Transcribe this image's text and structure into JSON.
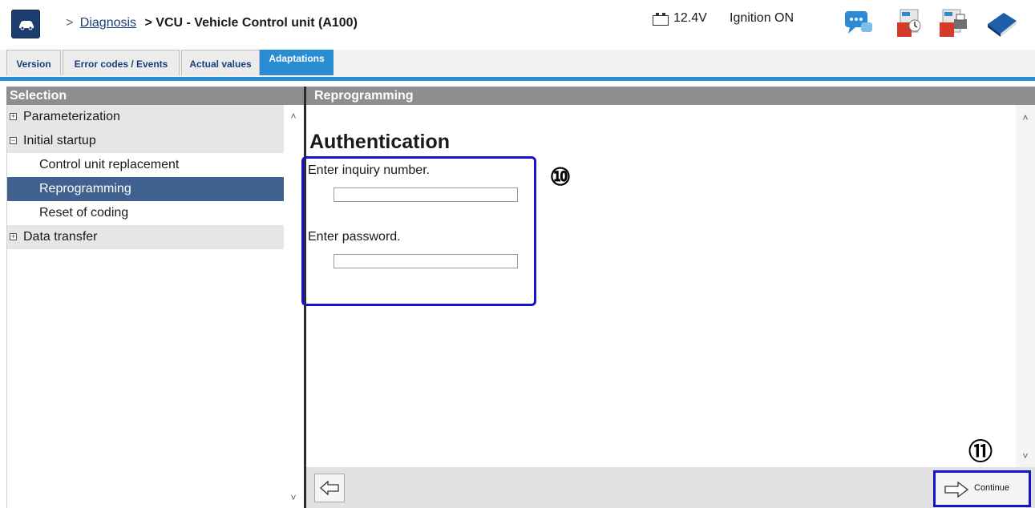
{
  "header": {
    "breadcrumb_sep": ">",
    "breadcrumb_link": "Diagnosis",
    "title": "> VCU - Vehicle Control unit (A100)",
    "voltage": "12.4V",
    "ignition": "Ignition ON",
    "icons": [
      "car-home-icon",
      "chat-icon",
      "pdf-clock-icon",
      "pdf-print-icon",
      "book-icon"
    ]
  },
  "tabs": [
    {
      "label": "Version",
      "active": false
    },
    {
      "label": "Error codes / Events",
      "active": false
    },
    {
      "label": "Actual values",
      "active": false
    },
    {
      "label": "Adaptations",
      "active": true
    }
  ],
  "left": {
    "header": "Selection",
    "tree": [
      {
        "label": "Parameterization",
        "type": "group",
        "expanded": false
      },
      {
        "label": "Initial startup",
        "type": "group",
        "expanded": true
      },
      {
        "label": "Control unit replacement",
        "type": "child",
        "selected": false
      },
      {
        "label": "Reprogramming",
        "type": "child",
        "selected": true
      },
      {
        "label": "Reset of coding",
        "type": "child",
        "selected": false
      },
      {
        "label": "Data transfer",
        "type": "group",
        "expanded": false
      }
    ]
  },
  "right": {
    "header": "Reprogramming",
    "title": "Authentication",
    "inquiry_label": "Enter inquiry number.",
    "inquiry_value": "",
    "password_label": "Enter password.",
    "password_value": "",
    "marker_a": "⑩",
    "marker_b": "⑪"
  },
  "footer": {
    "continue_label": "Continue"
  },
  "colors": {
    "accent": "#2a8dd4",
    "selection": "#41628f",
    "panel_header": "#8e8e8e",
    "highlight": "#1414c8"
  }
}
